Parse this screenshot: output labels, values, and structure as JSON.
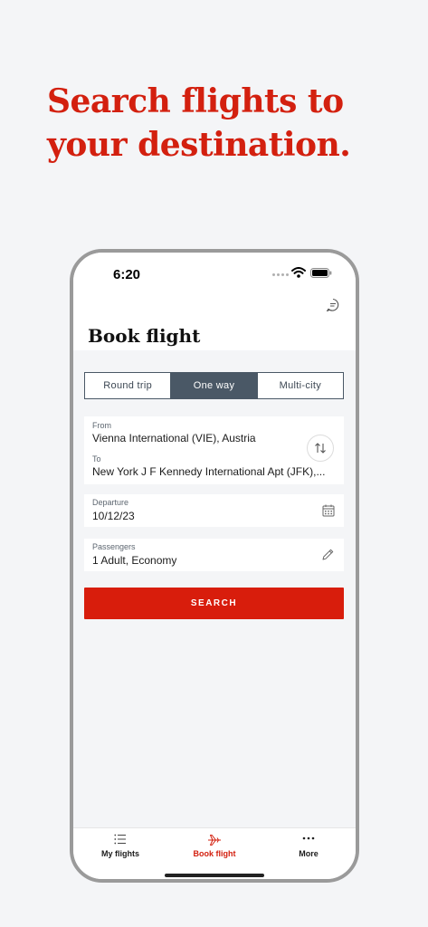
{
  "promo": {
    "headline_line1": "Search flights to",
    "headline_line2": "your destination."
  },
  "status_bar": {
    "time": "6:20"
  },
  "nav": {
    "title": "Book flight",
    "chat_icon": "chat-bubble-icon"
  },
  "trip_type": {
    "options": [
      "Round trip",
      "One way",
      "Multi-city"
    ],
    "selected": "One way"
  },
  "route": {
    "from_label": "From",
    "from_value": "Vienna International (VIE), Austria",
    "to_label": "To",
    "to_value": "New York J F Kennedy International Apt (JFK),...",
    "swap_icon": "swap-arrows-icon"
  },
  "departure": {
    "label": "Departure",
    "value": "10/12/23",
    "icon": "calendar-icon"
  },
  "passengers": {
    "label": "Passengers",
    "value": "1 Adult, Economy",
    "icon": "pencil-icon"
  },
  "search_label": "SEARCH",
  "tabbar": {
    "items": [
      {
        "label": "My flights",
        "icon": "list-icon"
      },
      {
        "label": "Book flight",
        "icon": "plane-icon"
      },
      {
        "label": "More",
        "icon": "more-dots-icon"
      }
    ],
    "active": "Book flight"
  },
  "colors": {
    "brand_red": "#d81d0c",
    "segment_dark": "#4a5866",
    "background": "#f4f5f7"
  }
}
